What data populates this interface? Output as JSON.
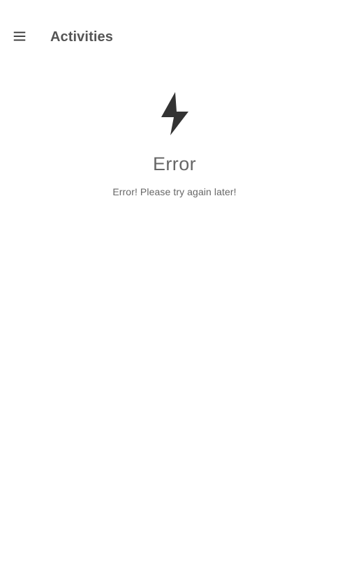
{
  "header": {
    "title": "Activities",
    "menu_icon": "menu-icon"
  },
  "error": {
    "icon": "lightning-bolt-icon",
    "title": "Error",
    "message": "Error! Please try again later!"
  },
  "colors": {
    "icon": "#333333",
    "text": "#666666",
    "title": "#555555",
    "background": "#ffffff"
  }
}
